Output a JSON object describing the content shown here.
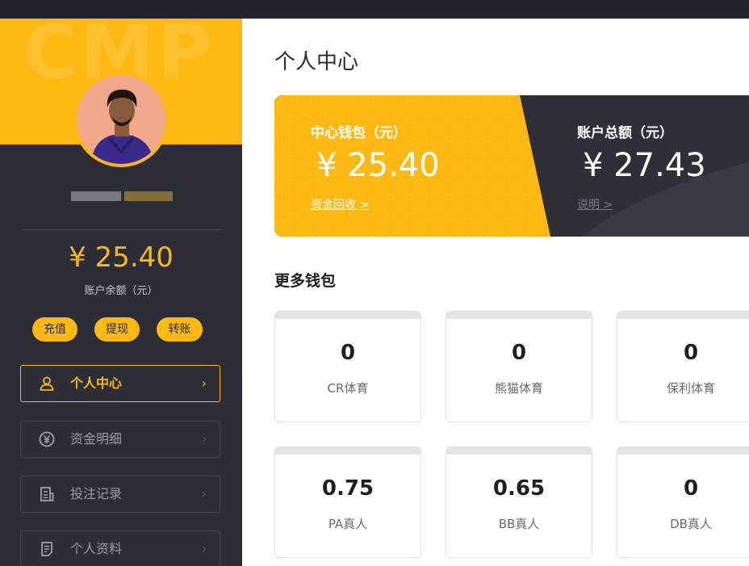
{
  "sidebar": {
    "balance": "¥ 25.40",
    "balance_label": "账户余额（元）",
    "actions": [
      "充值",
      "提现",
      "转账"
    ],
    "nav": [
      {
        "label": "个人中心",
        "icon": "user-icon",
        "active": true
      },
      {
        "label": "资金明细",
        "icon": "yen-circle-icon",
        "active": false
      },
      {
        "label": "投注记录",
        "icon": "document-icon",
        "active": false
      },
      {
        "label": "个人资料",
        "icon": "profile-note-icon",
        "active": false
      }
    ]
  },
  "main": {
    "title": "个人中心",
    "center_wallet": {
      "label": "中心钱包（元）",
      "amount": "¥ 25.40",
      "link": "资金回收 >"
    },
    "total": {
      "label": "账户总额（元）",
      "amount": "¥ 27.43",
      "link": "说明 >"
    },
    "more_title": "更多钱包",
    "wallets": [
      {
        "value": "0",
        "name": "CR体育"
      },
      {
        "value": "0",
        "name": "熊猫体育"
      },
      {
        "value": "0",
        "name": "保利体育"
      },
      {
        "value": "0.75",
        "name": "PA真人"
      },
      {
        "value": "0.65",
        "name": "BB真人"
      },
      {
        "value": "0",
        "name": "DB真人"
      }
    ]
  },
  "colors": {
    "accent": "#fdb812",
    "sidebar_bg": "#2d2d37",
    "card_dark": "#2f2f38"
  }
}
